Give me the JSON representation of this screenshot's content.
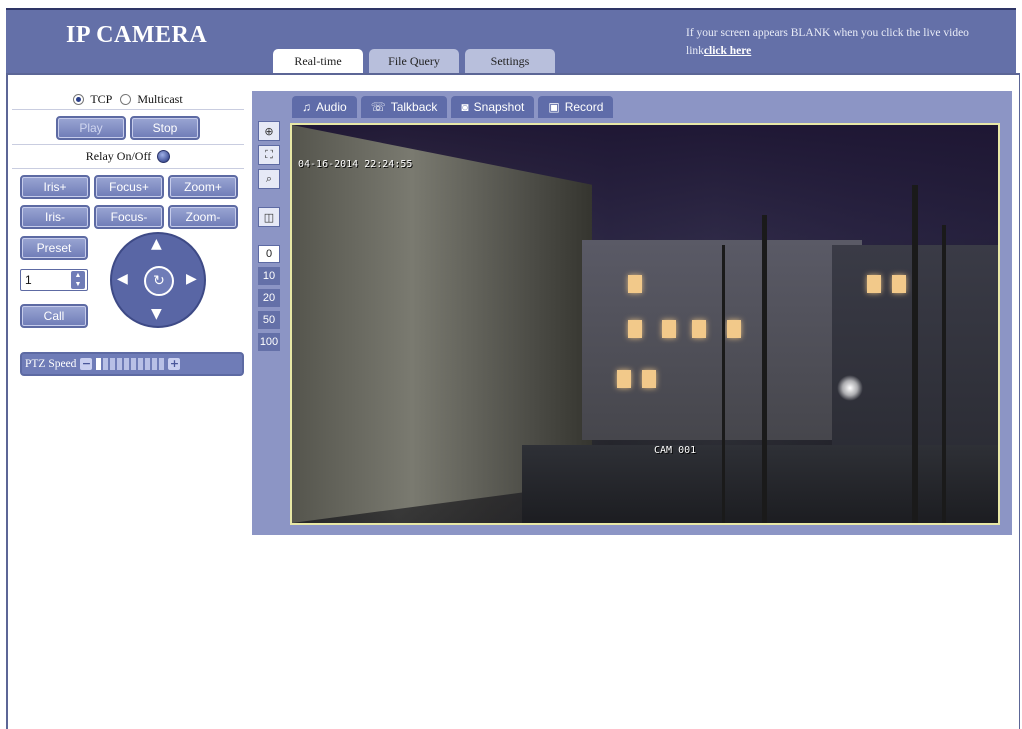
{
  "header": {
    "logo": "IP CAMERA",
    "notice_text": "If your screen appears BLANK when you click the live video link",
    "notice_link": "click here",
    "tabs": [
      {
        "label": "Real-time",
        "active": true
      },
      {
        "label": "File Query",
        "active": false
      },
      {
        "label": "Settings",
        "active": false
      }
    ]
  },
  "left_panel": {
    "protocol": {
      "tcp_label": "TCP",
      "multicast_label": "Multicast",
      "selected": "TCP"
    },
    "play_label": "Play",
    "stop_label": "Stop",
    "relay_label": "Relay On/Off",
    "lens_buttons_row1": [
      "Iris+",
      "Focus+",
      "Zoom+"
    ],
    "lens_buttons_row2": [
      "Iris-",
      "Focus-",
      "Zoom-"
    ],
    "preset_label": "Preset",
    "preset_value": "1",
    "call_label": "Call",
    "ptz_speed_label": "PTZ Speed",
    "ptz_speed_level": 1,
    "ptz_speed_max": 10
  },
  "video": {
    "tabs": [
      {
        "label": "Audio",
        "icon": "music-note-icon"
      },
      {
        "label": "Talkback",
        "icon": "talk-icon"
      },
      {
        "label": "Snapshot",
        "icon": "camera-icon"
      },
      {
        "label": "Record",
        "icon": "record-icon"
      }
    ],
    "zoom_levels": [
      "0",
      "10",
      "20",
      "50",
      "100"
    ],
    "zoom_selected": "0",
    "timestamp": "04-16-2014 22:24:55",
    "camera_label": "CAM 001"
  },
  "colors": {
    "header_bg": "#6470a8",
    "button_bg": "#6f7cb7",
    "video_border": "#e8e8a6"
  }
}
